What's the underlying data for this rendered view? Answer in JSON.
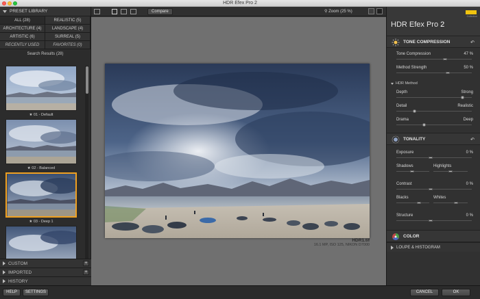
{
  "window": {
    "title": "HDR Efex Pro 2"
  },
  "preset_library": {
    "header": "PRESET LIBRARY",
    "categories": [
      {
        "label": "ALL (28)",
        "active": true
      },
      {
        "label": "REALISTIC (5)"
      },
      {
        "label": "ARCHITECTURE (4)"
      },
      {
        "label": "LANDSCAPE (4)"
      },
      {
        "label": "ARTISTIC (6)"
      },
      {
        "label": "SURREAL (5)"
      },
      {
        "label": "RECENTLY USED",
        "italic": true
      },
      {
        "label": "FAVORITES (0)",
        "italic": true
      }
    ],
    "results_label": "Search Results (28)",
    "presets": [
      {
        "caption": "★ 01 - Default",
        "selected": false
      },
      {
        "caption": "★ 02 - Balanced",
        "selected": false
      },
      {
        "caption": "★ 03 - Deep 1",
        "selected": true
      },
      {
        "caption": "",
        "selected": false
      }
    ],
    "lower_sections": [
      {
        "label": "CUSTOM",
        "has_add": true
      },
      {
        "label": "IMPORTED",
        "has_add": true
      },
      {
        "label": "HISTORY",
        "has_add": false
      }
    ]
  },
  "toolbar": {
    "compare_label": "Compare",
    "zoom_label": "Zoom (25 %)"
  },
  "image": {
    "filename": "HDR1.tif",
    "meta": "16.1 MP, ISO 125, NIKON D7000"
  },
  "right_panel": {
    "app_name": "HDR Efex Pro",
    "app_version": "2",
    "brand_sub": "Collection",
    "tone_compression": {
      "header": "TONE COMPRESSION",
      "controls": [
        {
          "label": "Tone Compression",
          "value": "47 %"
        },
        {
          "label": "Method Strength",
          "value": "50 %"
        }
      ],
      "method_header": "HDR Method",
      "method_controls": [
        {
          "left": "Depth",
          "right": "Strong"
        },
        {
          "left": "Detail",
          "right": "Realistic"
        },
        {
          "left": "Drama",
          "right": "Deep"
        }
      ]
    },
    "tonality": {
      "header": "TONALITY",
      "exposure": {
        "label": "Exposure",
        "value": "0 %"
      },
      "shadows_label": "Shadows",
      "highlights_label": "Highlights",
      "contrast": {
        "label": "Contrast",
        "value": "0 %"
      },
      "blacks_label": "Blacks",
      "whites_label": "Whites",
      "structure": {
        "label": "Structure",
        "value": "0 %"
      }
    },
    "color": {
      "header": "COLOR"
    },
    "loupe": {
      "header": "LOUPE & HISTOGRAM"
    }
  },
  "bottom_bar": {
    "help_label": "HELP",
    "settings_label": "SETTINGS",
    "cancel_label": "CANCEL",
    "ok_label": "OK"
  },
  "colors": {
    "accent_selected": "#f0a020",
    "brand_yellow": "#f1c40f"
  }
}
